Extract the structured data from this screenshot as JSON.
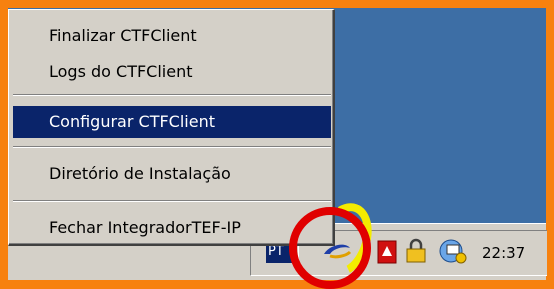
{
  "menu": {
    "items": [
      {
        "label": "Finalizar CTFClient"
      },
      {
        "label": "Logs do CTFClient"
      },
      {
        "label": "Configurar CTFClient"
      },
      {
        "label": "Diretório de Instalação"
      },
      {
        "label": "Fechar IntegradorTEF-IP"
      }
    ],
    "highlighted_index": 2,
    "highlight_color": "#0a246a"
  },
  "taskbar": {
    "language": "PT",
    "clock": "22:37",
    "tray_icons": [
      "ctfclient-icon",
      "pdf-icon",
      "lock-icon",
      "network-icon"
    ]
  },
  "annotation": {
    "color": "#e00000",
    "accent": "#f3ec00"
  }
}
